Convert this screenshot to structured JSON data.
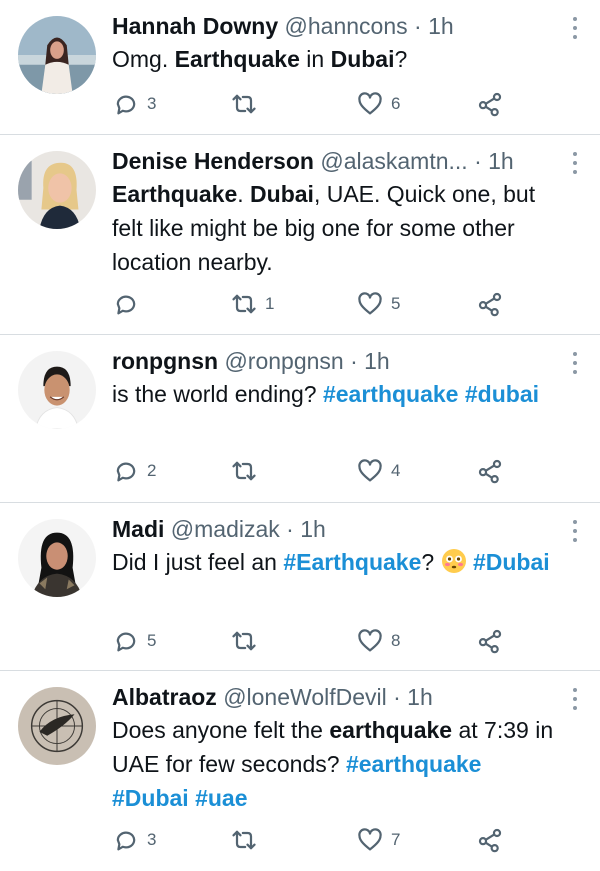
{
  "tweets": [
    {
      "name": "Hannah Downy",
      "handle": "@hanncons",
      "time": "· 1h",
      "text_parts": [
        {
          "t": "Omg. ",
          "style": "plain"
        },
        {
          "t": "Earthquake",
          "style": "bold"
        },
        {
          "t": " in ",
          "style": "plain"
        },
        {
          "t": "Dubai",
          "style": "bold"
        },
        {
          "t": "?",
          "style": "plain"
        }
      ],
      "replies": "3",
      "retweets": "",
      "likes": "6"
    },
    {
      "name": "Denise Henderson",
      "handle": "@alaskamtn...",
      "time": " · 1h",
      "text_parts": [
        {
          "t": "Earthquake",
          "style": "bold"
        },
        {
          "t": ". ",
          "style": "plain"
        },
        {
          "t": "Dubai",
          "style": "bold"
        },
        {
          "t": ", UAE. Quick one, but felt like might be big one for some other location nearby.",
          "style": "plain"
        }
      ],
      "replies": "",
      "retweets": "1",
      "likes": "5"
    },
    {
      "name": "ronpgnsn",
      "handle": "@ronpgnsn",
      "time": "· 1h",
      "text_parts": [
        {
          "t": "is the world ending? ",
          "style": "plain"
        },
        {
          "t": "#earthquake",
          "style": "hashtag"
        },
        {
          "t": " ",
          "style": "plain"
        },
        {
          "t": "#dubai",
          "style": "hashtag"
        }
      ],
      "replies": "2",
      "retweets": "",
      "likes": "4"
    },
    {
      "name": "Madi",
      "handle": "@madizak",
      "time": "· 1h",
      "text_parts": [
        {
          "t": "Did I just feel an ",
          "style": "plain"
        },
        {
          "t": "#Earthquake",
          "style": "hashtag"
        },
        {
          "t": "? ",
          "style": "plain"
        },
        {
          "t": "flushed-face-emoji",
          "style": "emoji"
        },
        {
          "t": " ",
          "style": "plain"
        },
        {
          "t": "#Dubai",
          "style": "hashtag"
        }
      ],
      "replies": "5",
      "retweets": "",
      "likes": "8"
    },
    {
      "name": "Albatraoz",
      "handle": "@loneWolfDevil",
      "time": "· 1h",
      "text_parts": [
        {
          "t": "Does anyone felt the ",
          "style": "plain"
        },
        {
          "t": "earthquake",
          "style": "bold"
        },
        {
          "t": " at 7:39 in UAE for few seconds? ",
          "style": "plain"
        },
        {
          "t": "#earthquake",
          "style": "hashtag"
        },
        {
          "t": " ",
          "style": "plain"
        },
        {
          "t": "#Dubai",
          "style": "hashtag"
        },
        {
          "t": " ",
          "style": "plain"
        },
        {
          "t": "#uae",
          "style": "hashtag"
        }
      ],
      "replies": "3",
      "retweets": "",
      "likes": "7"
    }
  ],
  "icons": {
    "reply": "reply-icon",
    "retweet": "retweet-icon",
    "like": "heart-icon",
    "share": "share-icon",
    "more": "more-options-icon"
  },
  "colors": {
    "hashtag": "#1b8fd6",
    "text": "#0f1419",
    "muted": "#536471",
    "divider": "#d8dde1"
  }
}
